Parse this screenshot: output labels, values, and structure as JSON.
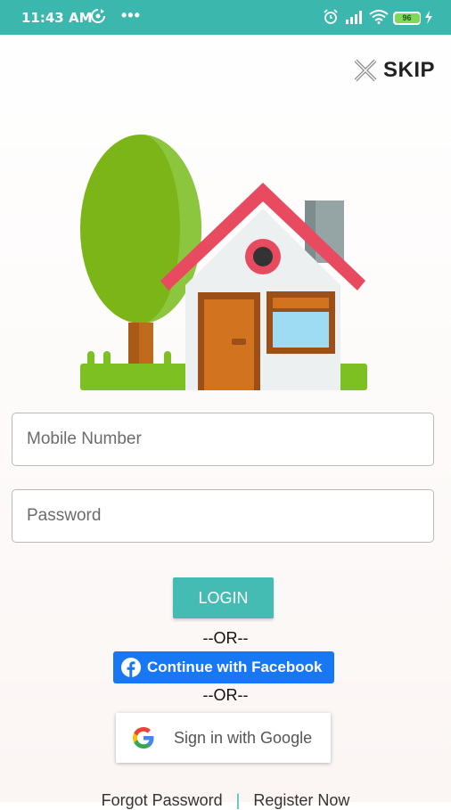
{
  "status_bar": {
    "time": "11:43 AM",
    "dots": "•••",
    "battery_level": "96",
    "icons": [
      "sync-icon",
      "alarm-icon",
      "signal-icon",
      "wifi-icon",
      "battery-icon",
      "charging-icon"
    ]
  },
  "skip": {
    "label": "SKIP",
    "icon": "close-icon"
  },
  "hero": {
    "illustration": "house-with-tree"
  },
  "form": {
    "mobile_placeholder": "Mobile Number",
    "password_placeholder": "Password",
    "login_label": "LOGIN"
  },
  "divider_text": "--OR--",
  "facebook": {
    "label": "Continue with Facebook",
    "color": "#1877f2"
  },
  "google": {
    "label": "Sign in with Google"
  },
  "footer": {
    "forgot": "Forgot Password",
    "separator": "|",
    "register": "Register Now"
  },
  "colors": {
    "accent": "#45bcb3",
    "status_bar": "#3bb7ad"
  }
}
